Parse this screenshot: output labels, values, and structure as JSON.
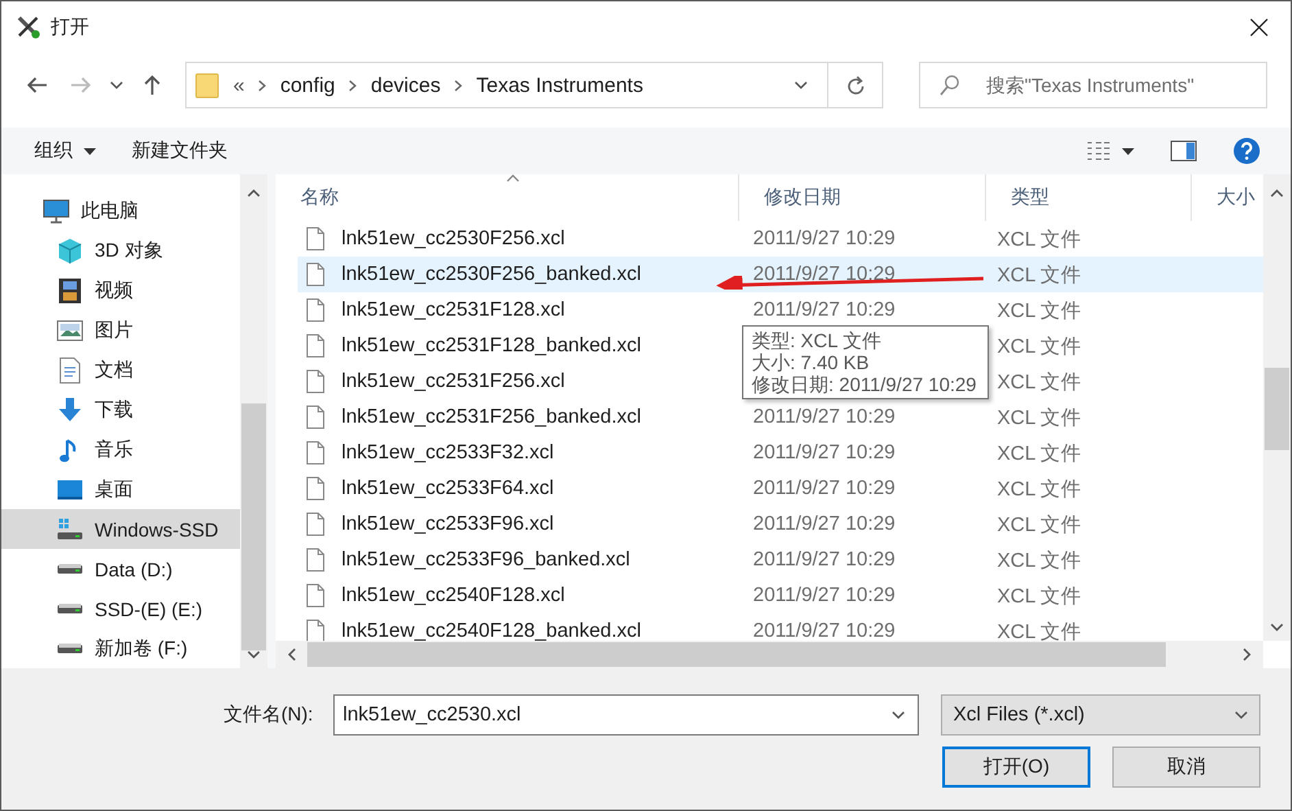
{
  "window": {
    "title": "打开"
  },
  "address_bar": {
    "overflow": "«",
    "crumbs": [
      "config",
      "devices",
      "Texas Instruments"
    ]
  },
  "search": {
    "placeholder": "搜索\"Texas Instruments\""
  },
  "toolbar": {
    "organize": "组织",
    "new_folder": "新建文件夹"
  },
  "sidebar": {
    "items": [
      {
        "label": "此电脑",
        "kind": "pc",
        "selected": false,
        "children": [
          {
            "label": "3D 对象",
            "kind": "cube",
            "selected": false
          },
          {
            "label": "视频",
            "kind": "film",
            "selected": false
          },
          {
            "label": "图片",
            "kind": "picture",
            "selected": false
          },
          {
            "label": "文档",
            "kind": "document",
            "selected": false
          },
          {
            "label": "下载",
            "kind": "download",
            "selected": false
          },
          {
            "label": "音乐",
            "kind": "music",
            "selected": false
          },
          {
            "label": "桌面",
            "kind": "desktop",
            "selected": false
          },
          {
            "label": "Windows-SSD",
            "kind": "system-drive",
            "selected": true
          },
          {
            "label": "Data (D:)",
            "kind": "drive",
            "selected": false
          },
          {
            "label": "SSD-(E) (E:)",
            "kind": "drive",
            "selected": false
          },
          {
            "label": "新加卷 (F:)",
            "kind": "drive",
            "selected": false
          }
        ]
      }
    ]
  },
  "table": {
    "columns": [
      "名称",
      "修改日期",
      "类型",
      "大小"
    ],
    "rows": [
      {
        "name": "lnk51ew_cc2530F256.xcl",
        "date": "2011/9/27 10:29",
        "type": "XCL 文件",
        "selected": false
      },
      {
        "name": "lnk51ew_cc2530F256_banked.xcl",
        "date": "2011/9/27 10:29",
        "type": "XCL 文件",
        "selected": true
      },
      {
        "name": "lnk51ew_cc2531F128.xcl",
        "date": "2011/9/27 10:29",
        "type": "XCL 文件",
        "selected": false
      },
      {
        "name": "lnk51ew_cc2531F128_banked.xcl",
        "type": "XCL 文件",
        "selected": false
      },
      {
        "name": "lnk51ew_cc2531F256.xcl",
        "type": "XCL 文件",
        "selected": false
      },
      {
        "name": "lnk51ew_cc2531F256_banked.xcl",
        "date": "2011/9/27 10:29",
        "type": "XCL 文件",
        "selected": false
      },
      {
        "name": "lnk51ew_cc2533F32.xcl",
        "date": "2011/9/27 10:29",
        "type": "XCL 文件",
        "selected": false
      },
      {
        "name": "lnk51ew_cc2533F64.xcl",
        "date": "2011/9/27 10:29",
        "type": "XCL 文件",
        "selected": false
      },
      {
        "name": "lnk51ew_cc2533F96.xcl",
        "date": "2011/9/27 10:29",
        "type": "XCL 文件",
        "selected": false
      },
      {
        "name": "lnk51ew_cc2533F96_banked.xcl",
        "date": "2011/9/27 10:29",
        "type": "XCL 文件",
        "selected": false
      },
      {
        "name": "lnk51ew_cc2540F128.xcl",
        "date": "2011/9/27 10:29",
        "type": "XCL 文件",
        "selected": false
      },
      {
        "name": "lnk51ew_cc2540F128_banked.xcl",
        "date": "2011/9/27 10:29",
        "type": "XCL 文件",
        "selected": false
      }
    ]
  },
  "tooltip": {
    "lines": [
      "类型: XCL 文件",
      "大小: 7.40 KB",
      "修改日期: 2011/9/27 10:29"
    ]
  },
  "filename": {
    "label": "文件名(N):",
    "value": "lnk51ew_cc2530.xcl"
  },
  "filter": {
    "value": "Xcl Files (*.xcl)"
  },
  "buttons": [
    {
      "label": "打开(O)",
      "kind": "default"
    },
    {
      "label": "取消",
      "kind": "normal"
    }
  ]
}
